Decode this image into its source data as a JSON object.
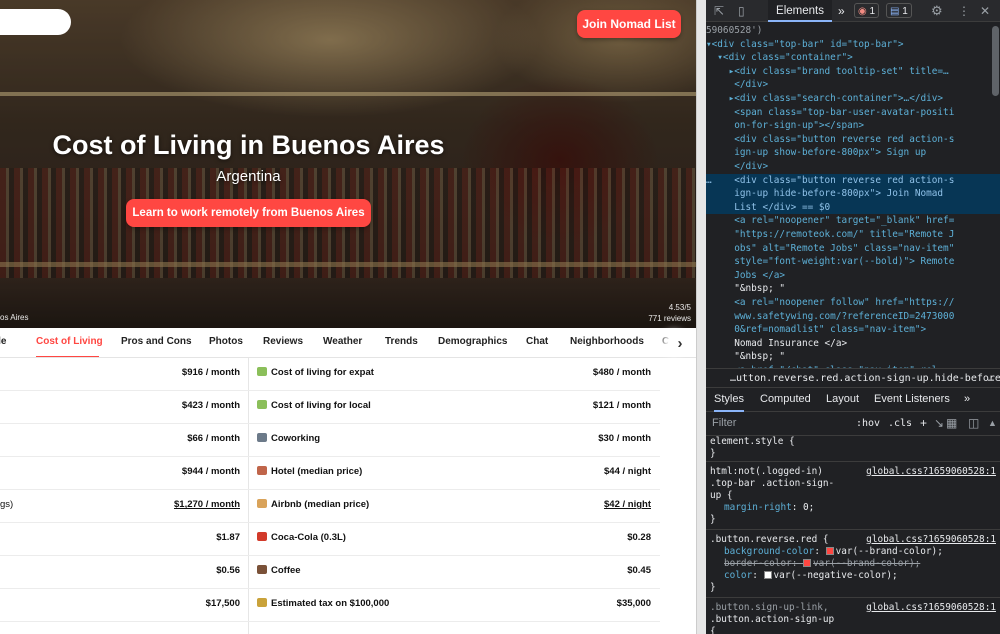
{
  "site": {
    "join_button": "Join Nomad List",
    "title": "Cost of Living in Buenos Aires",
    "subtitle": "Argentina",
    "learn_button": "Learn to work remotely from Buenos Aires",
    "photo_caption": "os Aires",
    "rating": "4.53/5",
    "reviews": "771 reviews",
    "tabs": [
      "ple",
      "Cost of Living",
      "Pros and Cons",
      "Photos",
      "Reviews",
      "Weather",
      "Trends",
      "Demographics",
      "Chat",
      "Neighborhoods",
      "C"
    ],
    "active_tab": "Cost of Living",
    "tab_next_icon": "chevron-right-icon",
    "rows": [
      {
        "left_label": "",
        "left_value": "$916 / month",
        "right_icon": "money-icon",
        "right_label": "Cost of living for expat",
        "right_value": "$480 / month"
      },
      {
        "left_label": "",
        "left_value": "$423 / month",
        "right_icon": "money-icon",
        "right_label": "Cost of living for local",
        "right_value": "$121 / month"
      },
      {
        "left_label": "",
        "left_value": "$66 / month",
        "right_icon": "office-icon",
        "right_label": "Coworking",
        "right_value": "$30 / month"
      },
      {
        "left_label": "",
        "left_value": "$944 / month",
        "right_icon": "hotel-icon",
        "right_label": "Hotel (median price)",
        "right_value": "$44 / night"
      },
      {
        "left_label": "gs)",
        "left_value": "$1,270 / month",
        "right_icon": "house-icon",
        "right_label": "Airbnb (median price)",
        "right_value": "$42 / night"
      },
      {
        "left_label": "",
        "left_value": "$1.87",
        "right_icon": "soda-icon",
        "right_label": "Coca-Cola (0.3L)",
        "right_value": "$0.28"
      },
      {
        "left_label": "",
        "left_value": "$0.56",
        "right_icon": "coffee-icon",
        "right_label": "Coffee",
        "right_value": "$0.45"
      },
      {
        "left_label": "",
        "left_value": "$17,500",
        "right_icon": "moneybag-icon",
        "right_label": "Estimated tax on $100,000",
        "right_value": "$35,000"
      }
    ]
  },
  "devtools": {
    "main_tab": "Elements",
    "more_tabs": "»",
    "error_count": "1",
    "message_count": "1",
    "breadcrumb": "…utton.reverse.red.action-sign-up.hide-before-800px",
    "breadcrumb_more": "…",
    "subtabs": [
      "Styles",
      "Computed",
      "Layout",
      "Event Listeners",
      "»"
    ],
    "filter_placeholder": "Filter",
    "hov": ":hov",
    "cls": ".cls",
    "dom_lines": [
      {
        "text": "59060528')",
        "kind": "link"
      },
      {
        "text": "▾<div class=\"top-bar\" id=\"top-bar\">",
        "kind": "tag"
      },
      {
        "text": "  ▾<div class=\"container\">",
        "kind": "tag"
      },
      {
        "text": "    ▸<div class=\"brand tooltip-set\" title=…",
        "kind": "tag"
      },
      {
        "text": "     </div>",
        "kind": "tag"
      },
      {
        "text": "    ▸<div class=\"search-container\">…</div>",
        "kind": "tag"
      },
      {
        "text": "     <span class=\"top-bar-user-avatar-positi",
        "kind": "tag"
      },
      {
        "text": "     on-for-sign-up\"></span>",
        "kind": "tag"
      },
      {
        "text": "     <div class=\"button reverse red action-s",
        "kind": "tag"
      },
      {
        "text": "     ign-up show-before-800px\"> Sign up",
        "kind": "tag"
      },
      {
        "text": "     </div>",
        "kind": "tag"
      },
      {
        "text": "…    <div class=\"button reverse red action-s",
        "kind": "sel"
      },
      {
        "text": "     ign-up hide-before-800px\"> Join Nomad",
        "kind": "sel"
      },
      {
        "text": "     List </div> == $0",
        "kind": "sel"
      },
      {
        "text": "     <a rel=\"noopener\" target=\"_blank\" href=",
        "kind": "tag"
      },
      {
        "text": "     \"https://remoteok.com/\" title=\"Remote J",
        "kind": "tag"
      },
      {
        "text": "     obs\" alt=\"Remote Jobs\" class=\"nav-item\"",
        "kind": "tag"
      },
      {
        "text": "     style=\"font-weight:var(--bold)\"> Remote",
        "kind": "tag"
      },
      {
        "text": "     Jobs </a>",
        "kind": "tag"
      },
      {
        "text": "     \"&nbsp; \"",
        "kind": "text"
      },
      {
        "text": "     <a rel=\"noopener follow\" href=\"https://",
        "kind": "tag"
      },
      {
        "text": "     www.safetywing.com/?referenceID=2473000",
        "kind": "tag"
      },
      {
        "text": "     0&ref=nomadlist\" class=\"nav-item\">",
        "kind": "tag"
      },
      {
        "text": "     Nomad Insurance </a>",
        "kind": "text"
      },
      {
        "text": "     \"&nbsp; \"",
        "kind": "text"
      },
      {
        "text": "     <a href=\"/chat\" class=\"nav-item\" rel=",
        "kind": "tag"
      }
    ],
    "styles": {
      "element_style": "element.style {",
      "close": "}",
      "rule1_selector": [
        "html:not(.logged-in)",
        ".top-bar .action-sign-",
        "up {"
      ],
      "rule1_source": "global.css?1659060528:1",
      "rule1_prop": "margin-right",
      "rule1_value": "0;",
      "rule2_selector": ".button.reverse.red {",
      "rule2_source": "global.css?1659060528:1",
      "rule2_props": [
        {
          "name": "background-color",
          "value": "var(--brand-color);",
          "swatch": "#ff4742",
          "strike": false
        },
        {
          "name": "border-color",
          "value": "var(--brand-color);",
          "swatch": "#ff4742",
          "strike": true
        },
        {
          "name": "color",
          "value": "var(--negative-color);",
          "swatch": "#ffffff",
          "strike": false
        }
      ],
      "rule3_selector": [
        ".button.sign-up-link,",
        ".button.action-sign-up",
        "{"
      ],
      "rule3_source": "global.css?1659060528:1"
    }
  },
  "colors": {
    "brand": "#ff4742",
    "devtools_bg": "#202124",
    "selection": "#073655"
  }
}
